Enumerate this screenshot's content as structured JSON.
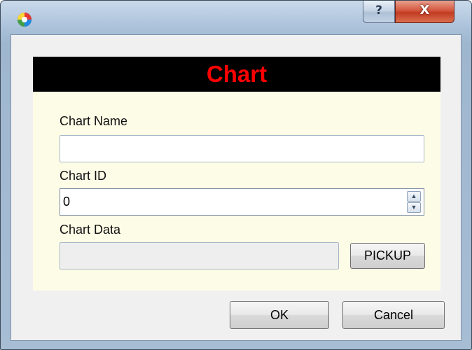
{
  "window": {
    "help_label": "?",
    "close_label": "X"
  },
  "header": {
    "title": "Chart",
    "title_color": "#ff0000",
    "background_color": "#000000"
  },
  "form": {
    "chart_name": {
      "label": "Chart Name",
      "value": ""
    },
    "chart_id": {
      "label": "Chart ID",
      "value": "0",
      "spin_up_icon": "▲",
      "spin_down_icon": "▼"
    },
    "chart_data": {
      "label": "Chart Data",
      "value": "",
      "button_label": "PICKUP"
    }
  },
  "footer": {
    "ok_label": "OK",
    "cancel_label": "Cancel"
  },
  "icons": {
    "app": "app-icon",
    "help": "help-icon",
    "close": "close-icon"
  },
  "colors": {
    "panel_background": "#fdfce6",
    "client_background": "#f0f0f0",
    "close_button": "#c23b22"
  }
}
